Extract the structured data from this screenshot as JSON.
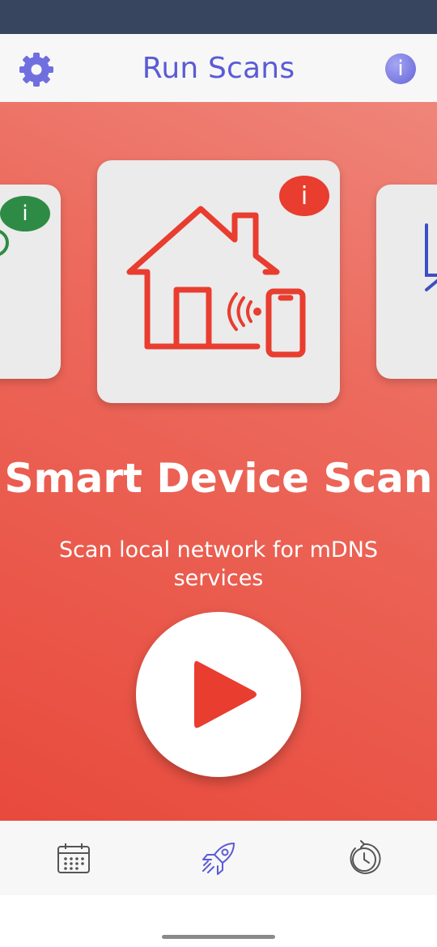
{
  "header": {
    "title": "Run Scans",
    "settings_icon": "gear-icon",
    "info_icon": "info-icon",
    "info_glyph": "i"
  },
  "carousel": {
    "left_card": {
      "badge": "i",
      "badge_color": "#2e8b45"
    },
    "center_card": {
      "icon": "smart-home-device-icon",
      "badge": "i",
      "badge_color": "#e83d2f",
      "icon_color": "#e83d2f"
    },
    "right_card": {
      "icon_color": "#3b4fc4"
    }
  },
  "scan": {
    "title": "Smart Device Scan",
    "description": "Scan local network for mDNS services",
    "play_icon": "play-icon"
  },
  "tabbar": {
    "items": [
      {
        "icon": "calendar-icon",
        "active": false
      },
      {
        "icon": "rocket-icon",
        "active": true
      },
      {
        "icon": "history-icon",
        "active": false
      }
    ]
  },
  "colors": {
    "accent": "#5b5bd6",
    "background_top": "#ef857a",
    "background_bottom": "#e84a3c",
    "status_bar": "#38455e"
  }
}
